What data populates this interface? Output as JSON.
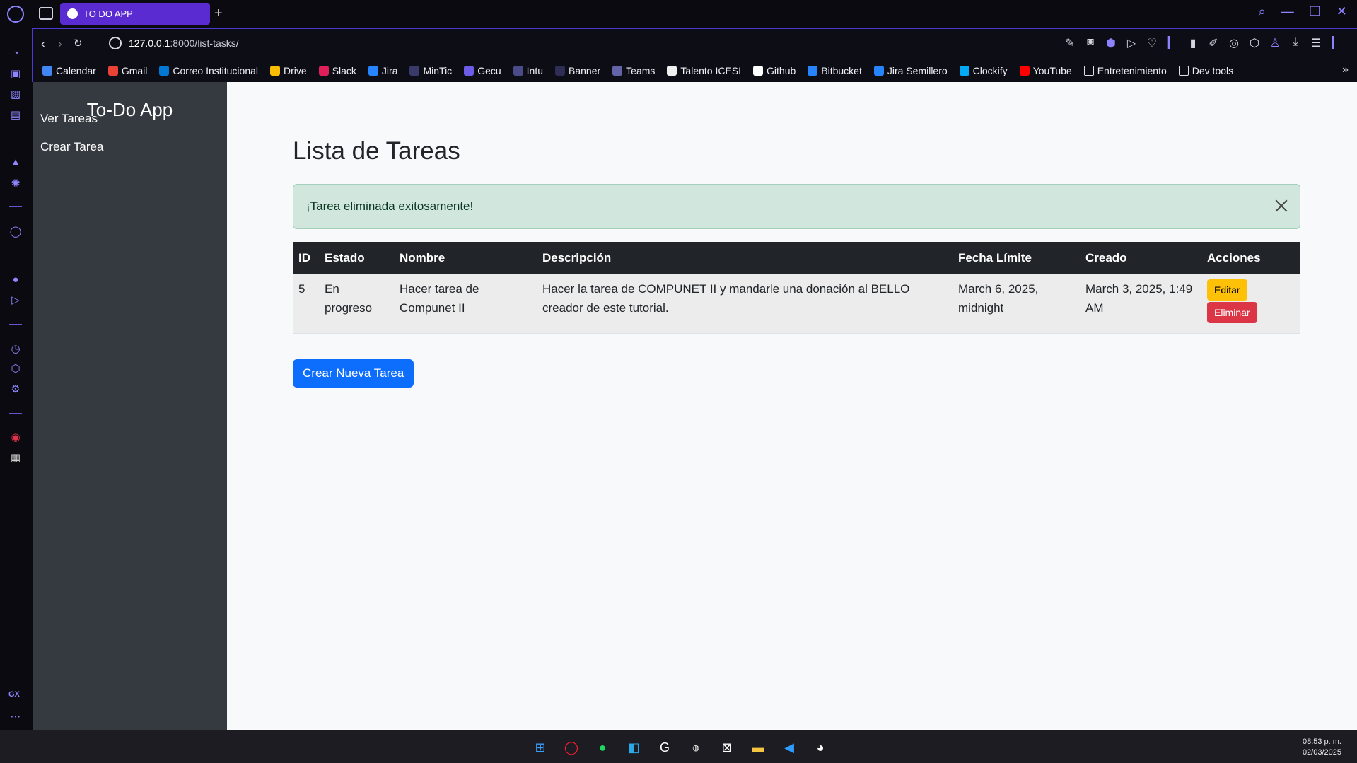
{
  "browser": {
    "tab_title": "TO DO APP",
    "url_host": "127.0.0.1",
    "url_path": ":8000/list-tasks/",
    "bookmarks": [
      {
        "label": "Calendar",
        "color": "#4285f4"
      },
      {
        "label": "Gmail",
        "color": "#ea4335"
      },
      {
        "label": "Correo Institucional",
        "color": "#0078d4"
      },
      {
        "label": "Drive",
        "color": "#fbbc04"
      },
      {
        "label": "Slack",
        "color": "#e01e5a"
      },
      {
        "label": "Jira",
        "color": "#2684ff"
      },
      {
        "label": "MinTic",
        "color": "#3a3a6a"
      },
      {
        "label": "Gecu",
        "color": "#6c5ce7"
      },
      {
        "label": "Intu",
        "color": "#4b4b8a"
      },
      {
        "label": "Banner",
        "color": "#2d2d55"
      },
      {
        "label": "Teams",
        "color": "#6264a7"
      },
      {
        "label": "Talento ICESI",
        "color": "#f0f0f0"
      },
      {
        "label": "Github",
        "color": "#ffffff"
      },
      {
        "label": "Bitbucket",
        "color": "#2684ff"
      },
      {
        "label": "Jira Semillero",
        "color": "#2684ff"
      },
      {
        "label": "Clockify",
        "color": "#03a9f4"
      },
      {
        "label": "YouTube",
        "color": "#ff0000"
      },
      {
        "label": "Entretenimiento",
        "color": "folder"
      },
      {
        "label": "Dev tools",
        "color": "folder"
      }
    ]
  },
  "sidebar": {
    "brand": "To-Do App",
    "links": [
      "Ver Tareas",
      "Crear Tarea"
    ]
  },
  "main": {
    "title": "Lista de Tareas",
    "alert": "¡Tarea eliminada exitosamente!",
    "table": {
      "headers": [
        "ID",
        "Estado",
        "Nombre",
        "Descripción",
        "Fecha Límite",
        "Creado",
        "Acciones"
      ],
      "rows": [
        {
          "id": "5",
          "estado": "En progreso",
          "nombre": "Hacer tarea de Compunet II",
          "descripcion": "Hacer la tarea de COMPUNET II y mandarle una donación al BELLO creador de este tutorial.",
          "fecha_limite": "March 6, 2025, midnight",
          "creado": "March 3, 2025, 1:49 AM",
          "edit_label": "Editar",
          "delete_label": "Eliminar"
        }
      ]
    },
    "create_button": "Crear Nueva Tarea"
  },
  "taskbar": {
    "time": "08:53 p. m.",
    "date": "02/03/2025"
  },
  "colors": {
    "sidebar_bg": "#343a40",
    "alert_bg": "#d1e7dd",
    "table_header_bg": "#212529",
    "edit_btn": "#ffc107",
    "delete_btn": "#dc3545",
    "primary_btn": "#0d6efd",
    "browser_accent": "#5a2bd0"
  }
}
